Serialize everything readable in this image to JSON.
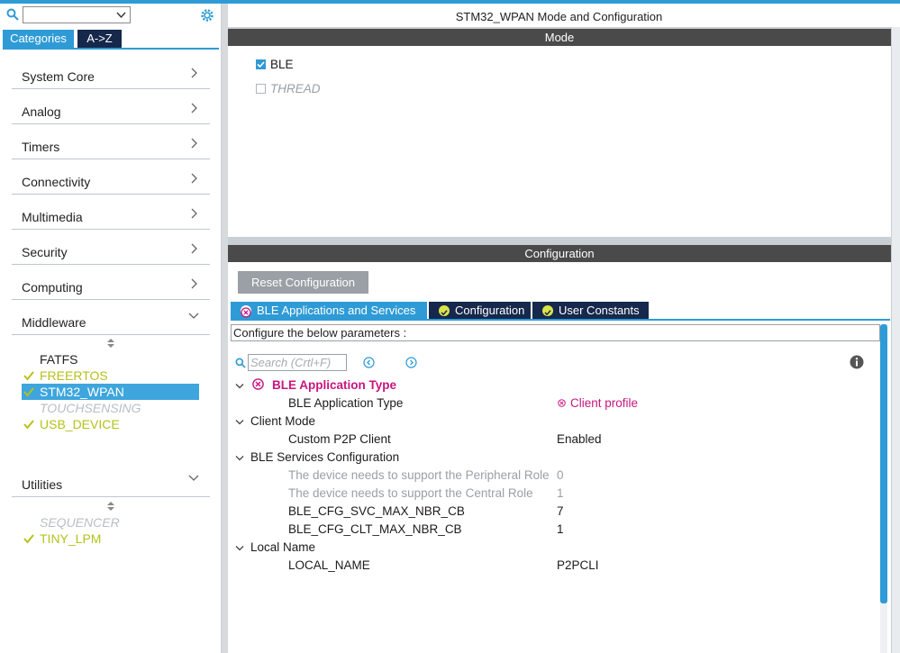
{
  "left": {
    "search_combo_value": "",
    "tabs": {
      "categories": "Categories",
      "az": "A->Z"
    },
    "categories": [
      {
        "label": "System Core"
      },
      {
        "label": "Analog"
      },
      {
        "label": "Timers"
      },
      {
        "label": "Connectivity"
      },
      {
        "label": "Multimedia"
      },
      {
        "label": "Security"
      },
      {
        "label": "Computing"
      },
      {
        "label": "Middleware"
      }
    ],
    "middleware_items": [
      {
        "label": "FATFS",
        "state": "plain"
      },
      {
        "label": "FREERTOS",
        "state": "ok"
      },
      {
        "label": "STM32_WPAN",
        "state": "selected"
      },
      {
        "label": "TOUCHSENSING",
        "state": "disabled"
      },
      {
        "label": "USB_DEVICE",
        "state": "ok"
      }
    ],
    "utilities_label": "Utilities",
    "utilities_items": [
      {
        "label": "SEQUENCER",
        "state": "disabled"
      },
      {
        "label": "TINY_LPM",
        "state": "ok"
      }
    ]
  },
  "main": {
    "title": "STM32_WPAN Mode and Configuration",
    "mode_band": "Mode",
    "mode_options": [
      {
        "label": "BLE",
        "checked": true
      },
      {
        "label": "THREAD",
        "checked": false
      }
    ],
    "config_band": "Configuration",
    "reset_button": "Reset Configuration",
    "config_tabs": [
      {
        "label": "BLE Applications and Services",
        "icon": "error-icon"
      },
      {
        "label": "Configuration",
        "icon": "check-icon"
      },
      {
        "label": "User Constants",
        "icon": "check-icon"
      }
    ],
    "configure_hint": "Configure the below parameters :",
    "search_placeholder": "Search (Crtl+F)",
    "groups": [
      {
        "label": "BLE Application Type",
        "error": true,
        "params": [
          {
            "name": "BLE Application Type",
            "value": "Client profile",
            "error": true
          }
        ]
      },
      {
        "label": "Client Mode",
        "params": [
          {
            "name": "Custom P2P Client",
            "value": "Enabled"
          }
        ]
      },
      {
        "label": "BLE Services Configuration",
        "params": [
          {
            "name": "The device needs to support the Peripheral Role",
            "value": "0",
            "disabled": true
          },
          {
            "name": "The device needs to support the Central Role",
            "value": "1",
            "disabled": true
          },
          {
            "name": "BLE_CFG_SVC_MAX_NBR_CB",
            "value": "7"
          },
          {
            "name": "BLE_CFG_CLT_MAX_NBR_CB",
            "value": "1"
          }
        ]
      },
      {
        "label": "Local Name",
        "params": [
          {
            "name": "LOCAL_NAME",
            "value": "P2PCLI"
          }
        ]
      }
    ]
  },
  "colors": {
    "accent": "#2f9bd6",
    "ok": "#b5c21a",
    "error": "#c8157f",
    "band": "#4a4a4a",
    "tab_dark": "#16284b"
  }
}
